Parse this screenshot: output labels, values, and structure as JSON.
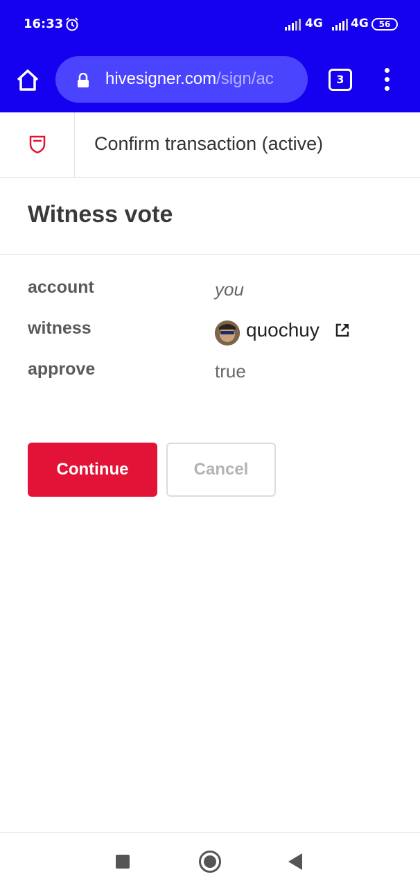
{
  "status_bar": {
    "time": "16:33",
    "network_1": "4G",
    "network_2": "4G",
    "battery": "56",
    "icons": [
      "alarm-icon",
      "signal-icon",
      "signal-icon",
      "battery-icon"
    ]
  },
  "browser": {
    "url_host": "hivesigner.com",
    "url_path": "/sign/ac",
    "tab_count": "3",
    "icons": [
      "home-icon",
      "lock-icon",
      "tabs-icon",
      "overflow-menu-icon"
    ]
  },
  "header": {
    "title": "Confirm transaction (active)",
    "logo_icon": "hivesigner-logo-icon",
    "accent_color": "#e31337"
  },
  "operation": {
    "title": "Witness vote",
    "rows": [
      {
        "key": "account",
        "value": "you"
      },
      {
        "key": "witness",
        "value": "quochuy"
      },
      {
        "key": "approve",
        "value": "true"
      }
    ]
  },
  "actions": {
    "continue_label": "Continue",
    "cancel_label": "Cancel"
  },
  "nav_bar": {
    "icons": [
      "recent-apps-icon",
      "home-circle-icon",
      "back-icon"
    ]
  },
  "colors": {
    "browser_chrome": "#1500ef",
    "url_bar": "#4b44ff",
    "primary_button": "#e31337"
  }
}
